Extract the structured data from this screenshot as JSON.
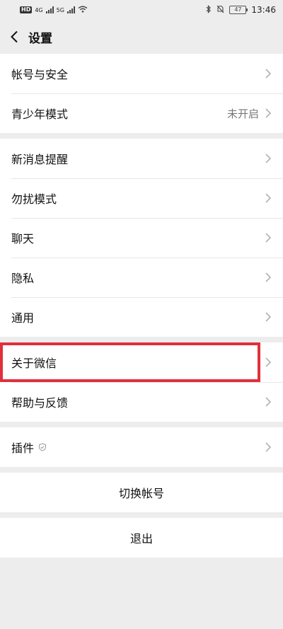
{
  "status_bar": {
    "hd_badge": "HD",
    "net1": "4G",
    "net2": "5G",
    "battery": "47",
    "time": "13:46"
  },
  "header": {
    "title": "设置"
  },
  "groups": [
    {
      "items": [
        {
          "label": "帐号与安全"
        },
        {
          "label": "青少年模式",
          "value": "未开启"
        }
      ]
    },
    {
      "items": [
        {
          "label": "新消息提醒"
        },
        {
          "label": "勿扰模式"
        },
        {
          "label": "聊天"
        },
        {
          "label": "隐私"
        },
        {
          "label": "通用"
        }
      ]
    },
    {
      "items": [
        {
          "label": "关于微信"
        },
        {
          "label": "帮助与反馈"
        }
      ]
    },
    {
      "items": [
        {
          "label": "插件"
        }
      ]
    }
  ],
  "actions": {
    "switch_account": "切换帐号",
    "logout": "退出"
  },
  "colors": {
    "highlight": "#e0303a",
    "background": "#ededed"
  }
}
